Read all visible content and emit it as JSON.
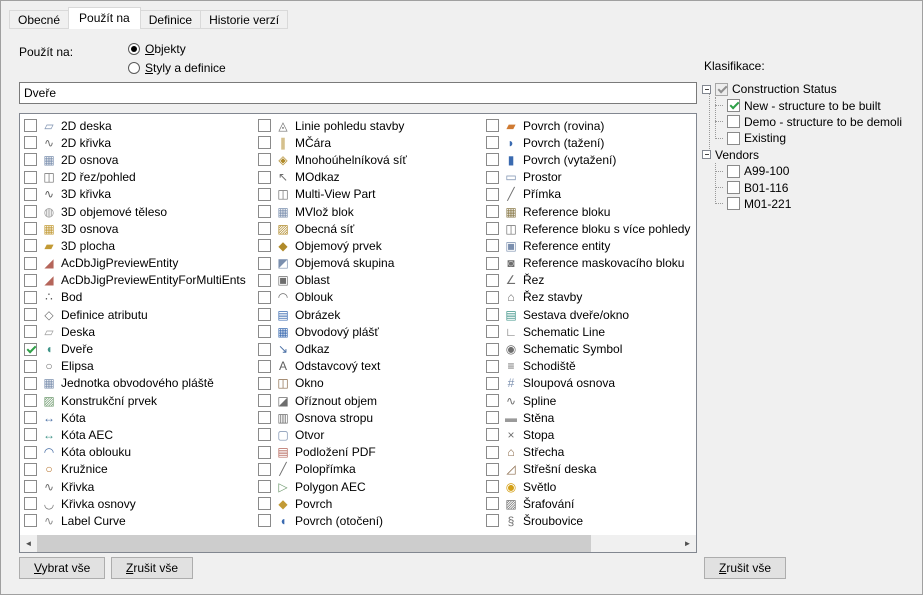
{
  "tabs": [
    {
      "label": "Obecné",
      "active": false
    },
    {
      "label": "Použít na",
      "active": true
    },
    {
      "label": "Definice",
      "active": false
    },
    {
      "label": "Historie verzí",
      "active": false
    }
  ],
  "apply_to": {
    "label": "Použít na:",
    "radios": [
      {
        "label": "Objekty",
        "selected": true
      },
      {
        "label": "Styly a definice",
        "selected": false
      }
    ]
  },
  "filter": {
    "value": "Dveře"
  },
  "object_list": {
    "columns": [
      [
        {
          "label": "2D deska",
          "icon": "▱",
          "color": "#7b8fae"
        },
        {
          "label": "2D křivka",
          "icon": "∿",
          "color": "#6e6e6e"
        },
        {
          "label": "2D osnova",
          "icon": "▦",
          "color": "#7b8fae"
        },
        {
          "label": "2D řez/pohled",
          "icon": "◫",
          "color": "#6e6e6e"
        },
        {
          "label": "3D křivka",
          "icon": "∿",
          "color": "#5e5e5e"
        },
        {
          "label": "3D objemové těleso",
          "icon": "◍",
          "color": "#9a9a9a"
        },
        {
          "label": "3D osnova",
          "icon": "▦",
          "color": "#c29a35"
        },
        {
          "label": "3D plocha",
          "icon": "▰",
          "color": "#c29a35"
        },
        {
          "label": "AcDbJigPreviewEntity",
          "icon": "◢",
          "color": "#b5655a"
        },
        {
          "label": "AcDbJigPreviewEntityForMultiEnts",
          "icon": "◢",
          "color": "#b5655a"
        },
        {
          "label": "Bod",
          "icon": "∴",
          "color": "#5e5e5e"
        },
        {
          "label": "Definice atributu",
          "icon": "◇",
          "color": "#6e6e6e"
        },
        {
          "label": "Deska",
          "icon": "▱",
          "color": "#9a9a9a"
        },
        {
          "label": "Dveře",
          "icon": "◖",
          "color": "#3f9488",
          "checked": true
        },
        {
          "label": "Elipsa",
          "icon": "○",
          "color": "#6e6e6e"
        },
        {
          "label": "Jednotka obvodového pláště",
          "icon": "▦",
          "color": "#7b8fae"
        },
        {
          "label": "Konstrukční prvek",
          "icon": "▨",
          "color": "#6f9a6f"
        },
        {
          "label": "Kóta",
          "icon": "↔",
          "color": "#4a6fa5"
        },
        {
          "label": "Kóta AEC",
          "icon": "↔",
          "color": "#3f9488"
        },
        {
          "label": "Kóta oblouku",
          "icon": "◠",
          "color": "#4a6fa5"
        },
        {
          "label": "Kružnice",
          "icon": "○",
          "color": "#b5722a"
        },
        {
          "label": "Křivka",
          "icon": "∿",
          "color": "#6e6e6e"
        },
        {
          "label": "Křivka osnovy",
          "icon": "◡",
          "color": "#6e6e6e"
        },
        {
          "label": "Label Curve",
          "icon": "∿",
          "color": "#8a8a8a"
        }
      ],
      [
        {
          "label": "Linie pohledu stavby",
          "icon": "◬",
          "color": "#6e6e6e"
        },
        {
          "label": "MČára",
          "icon": "∥",
          "color": "#b08a2a"
        },
        {
          "label": "Mnohoúhelníková síť",
          "icon": "◈",
          "color": "#b08a2a"
        },
        {
          "label": "MOdkaz",
          "icon": "↖",
          "color": "#6e6e6e"
        },
        {
          "label": "Multi-View Part",
          "icon": "◫",
          "color": "#6e6e6e"
        },
        {
          "label": "MVlož blok",
          "icon": "▦",
          "color": "#7b8fae"
        },
        {
          "label": "Obecná síť",
          "icon": "▨",
          "color": "#b08a2a"
        },
        {
          "label": "Objemový prvek",
          "icon": "◆",
          "color": "#b08a2a"
        },
        {
          "label": "Objemová skupina",
          "icon": "◩",
          "color": "#7b8fae"
        },
        {
          "label": "Oblast",
          "icon": "▣",
          "color": "#6e6e6e"
        },
        {
          "label": "Oblouk",
          "icon": "◠",
          "color": "#6e6e6e"
        },
        {
          "label": "Obrázek",
          "icon": "▤",
          "color": "#3a6ab0"
        },
        {
          "label": "Obvodový plášť",
          "icon": "▦",
          "color": "#3a6ab0"
        },
        {
          "label": "Odkaz",
          "icon": "↘",
          "color": "#4a6fa5"
        },
        {
          "label": "Odstavcový text",
          "icon": "A",
          "color": "#5e5e5e"
        },
        {
          "label": "Okno",
          "icon": "◫",
          "color": "#8a6a4a"
        },
        {
          "label": "Oříznout objem",
          "icon": "◪",
          "color": "#6e6e6e"
        },
        {
          "label": "Osnova stropu",
          "icon": "▥",
          "color": "#6e6e6e"
        },
        {
          "label": "Otvor",
          "icon": "▢",
          "color": "#7b8fae"
        },
        {
          "label": "Podložení PDF",
          "icon": "▤",
          "color": "#b5655a"
        },
        {
          "label": "Polopřímka",
          "icon": "╱",
          "color": "#6e6e6e"
        },
        {
          "label": "Polygon AEC",
          "icon": "▷",
          "color": "#6f9a6f"
        },
        {
          "label": "Povrch",
          "icon": "◆",
          "color": "#c29a35"
        },
        {
          "label": "Povrch (otočení)",
          "icon": "◖",
          "color": "#3a6ab0"
        }
      ],
      [
        {
          "label": "Povrch (rovina)",
          "icon": "▰",
          "color": "#cf7a32"
        },
        {
          "label": "Povrch (tažení)",
          "icon": "◗",
          "color": "#3a6ab0"
        },
        {
          "label": "Povrch (vytažení)",
          "icon": "▮",
          "color": "#3a6ab0"
        },
        {
          "label": "Prostor",
          "icon": "▭",
          "color": "#7b8fae"
        },
        {
          "label": "Přímka",
          "icon": "╱",
          "color": "#6e6e6e"
        },
        {
          "label": "Reference bloku",
          "icon": "▦",
          "color": "#8a7a4a"
        },
        {
          "label": "Reference bloku s více pohledy",
          "icon": "◫",
          "color": "#6e6e6e"
        },
        {
          "label": "Reference entity",
          "icon": "▣",
          "color": "#7b8fae"
        },
        {
          "label": "Reference maskovacího bloku",
          "icon": "◙",
          "color": "#6e6e6e"
        },
        {
          "label": "Řez",
          "icon": "∠",
          "color": "#6e6e6e"
        },
        {
          "label": "Řez stavby",
          "icon": "⌂",
          "color": "#6e6e6e"
        },
        {
          "label": "Sestava dveře/okno",
          "icon": "▤",
          "color": "#3f9488"
        },
        {
          "label": "Schematic Line",
          "icon": "∟",
          "color": "#6e6e6e"
        },
        {
          "label": "Schematic Symbol",
          "icon": "◉",
          "color": "#6e6e6e"
        },
        {
          "label": "Schodiště",
          "icon": "≡",
          "color": "#6e6e6e"
        },
        {
          "label": "Sloupová osnova",
          "icon": "#",
          "color": "#7b8fae"
        },
        {
          "label": "Spline",
          "icon": "∿",
          "color": "#6e6e6e"
        },
        {
          "label": "Stěna",
          "icon": "▬",
          "color": "#9a9a9a"
        },
        {
          "label": "Stopa",
          "icon": "×",
          "color": "#6e6e6e"
        },
        {
          "label": "Střecha",
          "icon": "⌂",
          "color": "#8a6a4a"
        },
        {
          "label": "Střešní deska",
          "icon": "◿",
          "color": "#8a6a4a"
        },
        {
          "label": "Světlo",
          "icon": "◉",
          "color": "#d4a017"
        },
        {
          "label": "Šrafování",
          "icon": "▨",
          "color": "#6e6e6e"
        },
        {
          "label": "Šroubovice",
          "icon": "§",
          "color": "#6e6e6e"
        }
      ]
    ]
  },
  "scrollbar": {
    "left_arrow": "◄",
    "right_arrow": "►"
  },
  "classification": {
    "label": "Klasifikace:",
    "tree": [
      {
        "label": "Construction Status",
        "level": 0,
        "checkbox": "mixed"
      },
      {
        "label": "New - structure to be built",
        "level": 1,
        "checkbox": "checked"
      },
      {
        "label": "Demo - structure to be demoli",
        "level": 1,
        "checkbox": "unchecked"
      },
      {
        "label": "Existing",
        "level": 1,
        "checkbox": "unchecked"
      },
      {
        "label": "Vendors",
        "level": 0,
        "checkbox": "none"
      },
      {
        "label": "A99-100",
        "level": 1,
        "checkbox": "unchecked"
      },
      {
        "label": "B01-116",
        "level": 1,
        "checkbox": "unchecked"
      },
      {
        "label": "M01-221",
        "level": 1,
        "checkbox": "unchecked"
      }
    ]
  },
  "buttons": {
    "select_all": "Vybrat vše",
    "deselect_all_left": "Zrušit vše",
    "deselect_all_right": "Zrušit vše"
  }
}
